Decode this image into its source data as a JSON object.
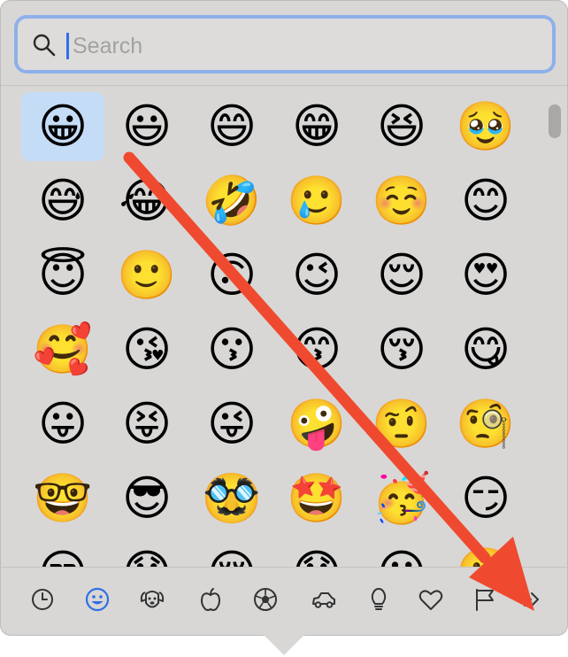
{
  "search": {
    "placeholder": "Search",
    "value": ""
  },
  "emojis": [
    "😀",
    "😃",
    "😄",
    "😁",
    "😆",
    "🥹",
    "😅",
    "😂",
    "🤣",
    "🥲",
    "☺️",
    "😊",
    "😇",
    "🙂",
    "🙃",
    "😉",
    "😌",
    "😍",
    "🥰",
    "😘",
    "😗",
    "😙",
    "😚",
    "😋",
    "😛",
    "😝",
    "😜",
    "🤪",
    "🤨",
    "🧐",
    "🤓",
    "😎",
    "🥸",
    "🤩",
    "🥳",
    "😏",
    "😒",
    "😞",
    "😔",
    "😟",
    "😕",
    "🙁"
  ],
  "selected_index": 0,
  "categories": [
    {
      "name": "recents",
      "icon": "clock-icon",
      "active": false
    },
    {
      "name": "smileys",
      "icon": "smiley-icon",
      "active": true
    },
    {
      "name": "animals",
      "icon": "dog-icon",
      "active": false
    },
    {
      "name": "food",
      "icon": "apple-icon",
      "active": false
    },
    {
      "name": "activity",
      "icon": "soccer-ball-icon",
      "active": false
    },
    {
      "name": "travel",
      "icon": "car-icon",
      "active": false
    },
    {
      "name": "objects",
      "icon": "lightbulb-icon",
      "active": false
    },
    {
      "name": "symbols",
      "icon": "heart-icon",
      "active": false
    },
    {
      "name": "flags",
      "icon": "flag-icon",
      "active": false
    },
    {
      "name": "more",
      "icon": "chevrons-right-icon",
      "active": false
    }
  ],
  "colors": {
    "accent": "#2f6fe6",
    "annotation_arrow": "#ef4a2f",
    "panel": "#d8d7d6"
  }
}
